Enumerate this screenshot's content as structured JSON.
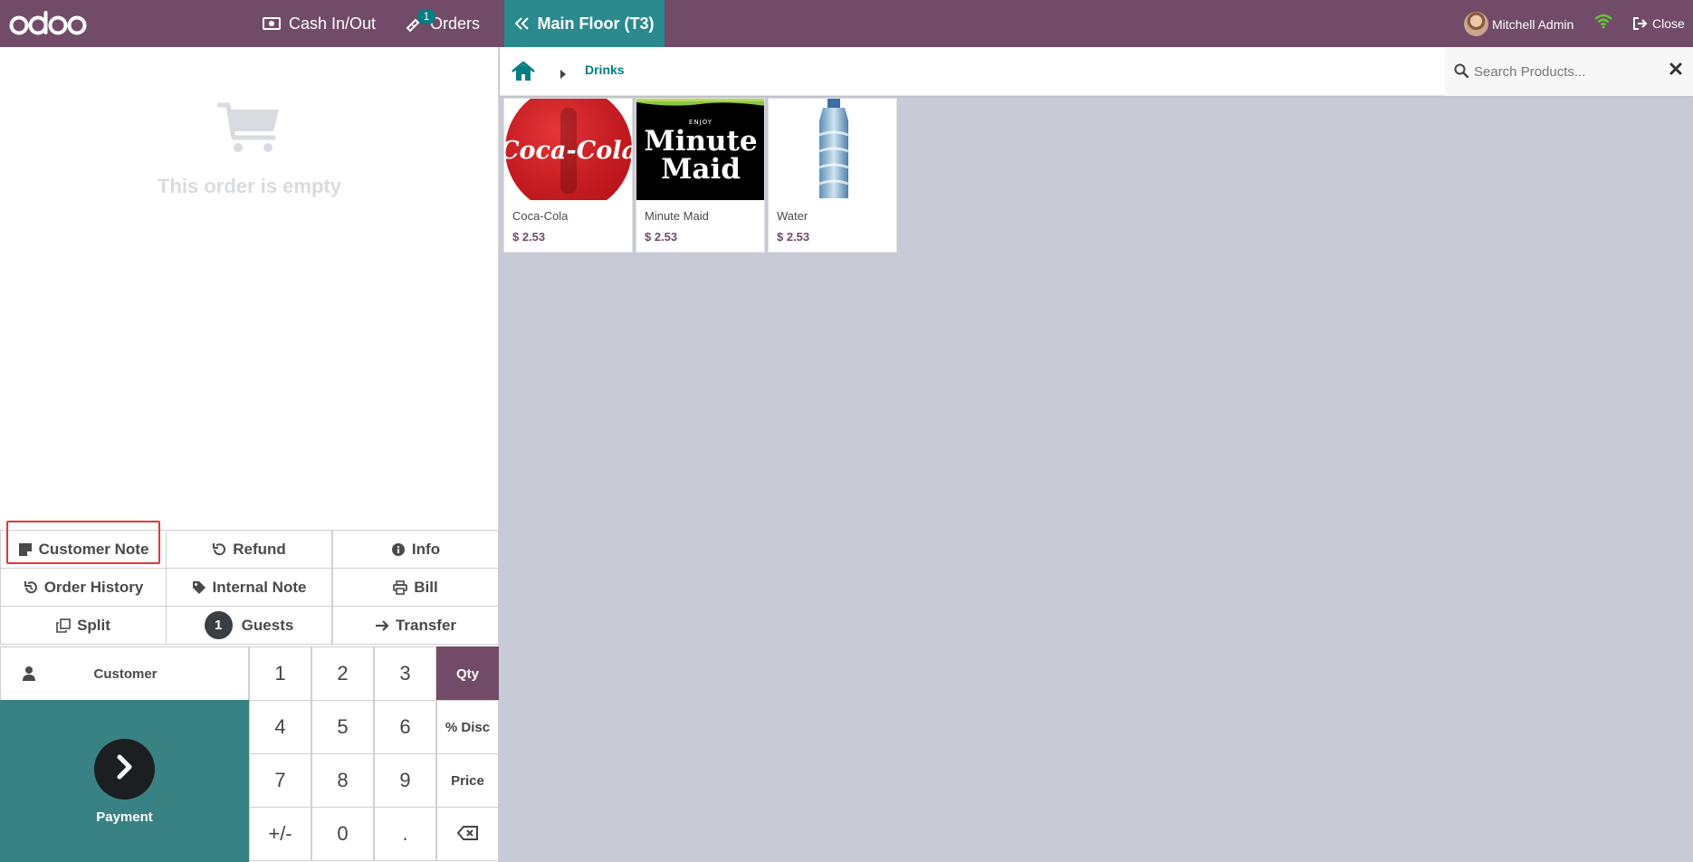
{
  "header": {
    "logo": "odoo",
    "cash_in_out": "Cash In/Out",
    "orders": "Orders",
    "orders_badge": "1",
    "floor": "Main Floor  (T3)",
    "user": "Mitchell Admin",
    "close": "Close"
  },
  "order": {
    "empty_message": "This order is empty"
  },
  "actions": {
    "customer_note": "Customer Note",
    "refund": "Refund",
    "info": "Info",
    "order_history": "Order History",
    "internal_note": "Internal Note",
    "bill": "Bill",
    "split": "Split",
    "guests_count": "1",
    "guests": "Guests",
    "transfer": "Transfer"
  },
  "customer": {
    "label": "Customer"
  },
  "payment": {
    "label": "Payment"
  },
  "numpad": {
    "keys": [
      "1",
      "2",
      "3",
      "4",
      "5",
      "6",
      "7",
      "8",
      "9",
      "+/-",
      "0",
      "."
    ],
    "modes": [
      "Qty",
      "% Disc",
      "Price"
    ],
    "active_mode": "Qty"
  },
  "breadcrumb": {
    "category": "Drinks"
  },
  "search": {
    "placeholder": "Search Products..."
  },
  "products": [
    {
      "name": "Coca-Cola",
      "price": "$ 2.53",
      "image_text": "Coca-Cola"
    },
    {
      "name": "Minute Maid",
      "price": "$ 2.53",
      "image_text_top": "ENJOY",
      "image_text_1": "Minute",
      "image_text_2": "Maid"
    },
    {
      "name": "Water",
      "price": "$ 2.53"
    }
  ],
  "colors": {
    "brand": "#714b67",
    "accent": "#017e84",
    "floor_tab": "#2a8a8d",
    "payment_bg": "#398283",
    "highlight": "#e23838"
  }
}
